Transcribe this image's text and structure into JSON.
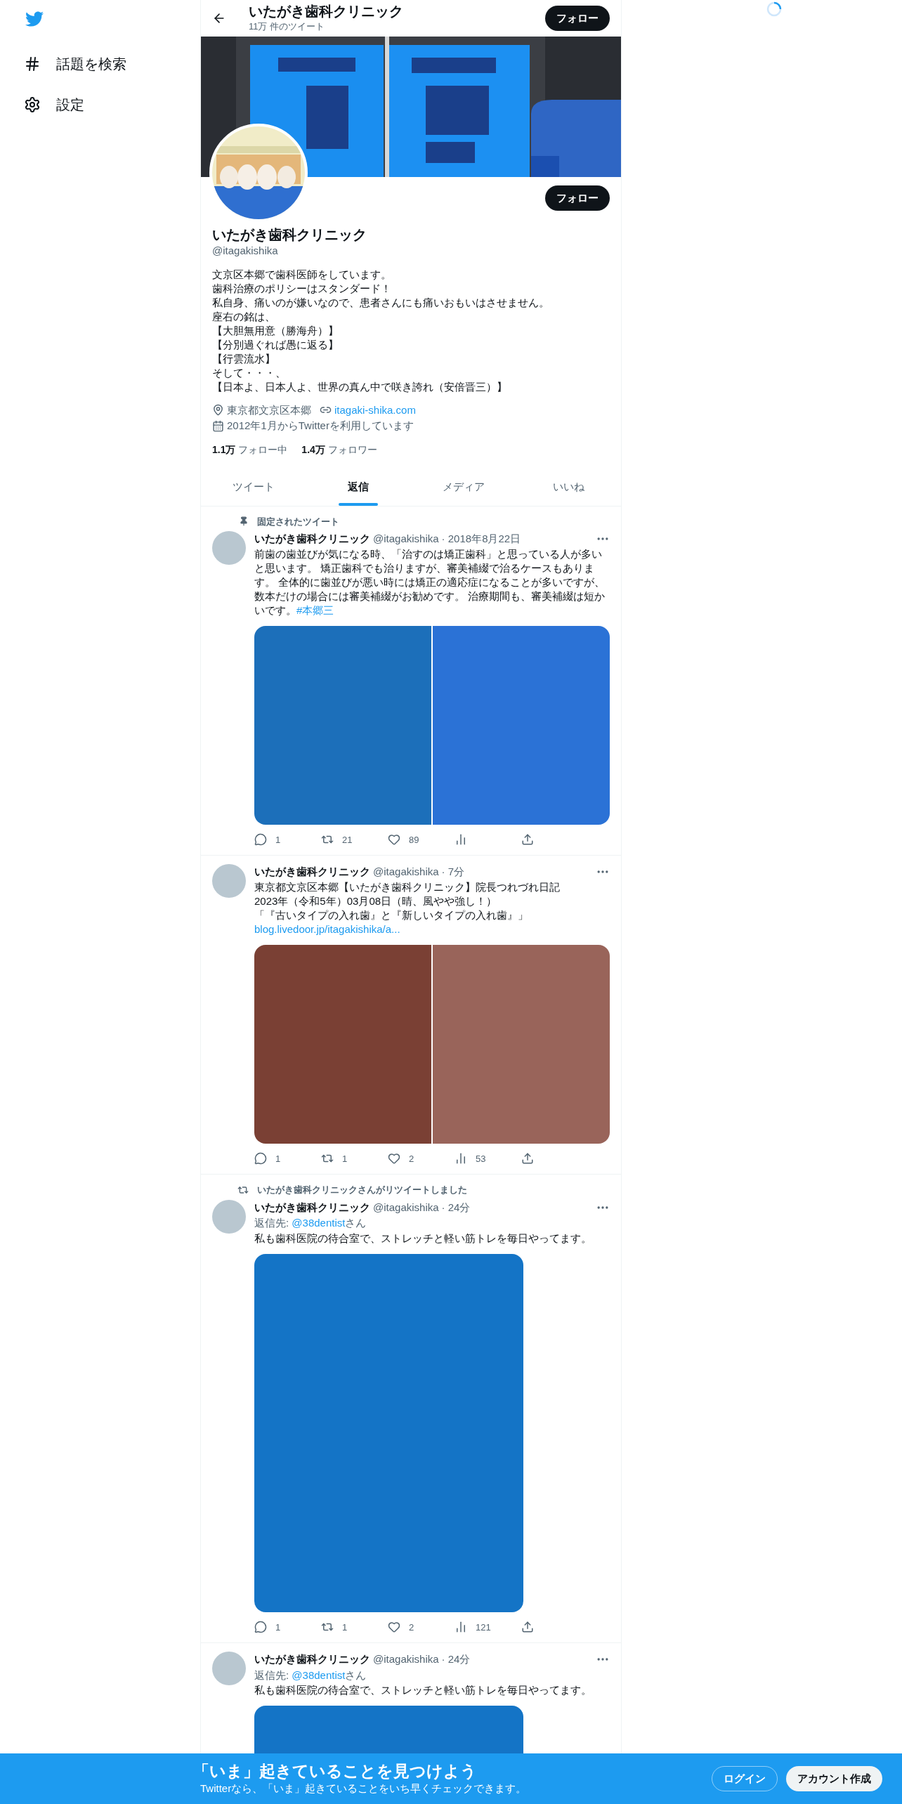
{
  "sidebar": {
    "items": [
      {
        "kind": "hash",
        "label": "話題を検索"
      },
      {
        "kind": "settings",
        "label": "設定"
      }
    ]
  },
  "header": {
    "title": "いたがき歯科クリニック",
    "subtitle": "11万 件のツイート",
    "follow_button": "フォロー"
  },
  "profile": {
    "follow_button": "フォロー",
    "name": "いたがき歯科クリニック",
    "handle": "@itagakishika",
    "bio": [
      "文京区本郷で歯科医師をしています。",
      "歯科治療のポリシーはスタンダード！",
      "私自身、痛いのが嫌いなので、患者さんにも痛いおもいはさせません。",
      "座右の銘は、",
      "【大胆無用意（勝海舟）】",
      "【分別過ぐれば愚に返る】",
      "【行雲流水】",
      "そして・・・、",
      "【日本よ、日本人よ、世界の真ん中で咲き誇れ（安倍晋三）】"
    ],
    "location": "東京都文京区本郷",
    "website": "itagaki-shika.com",
    "joined": "2012年1月からTwitterを利用しています",
    "following": {
      "count": "1.1万",
      "label": "フォロー中"
    },
    "followers": {
      "count": "1.4万",
      "label": "フォロワー"
    }
  },
  "tabs": [
    {
      "label": "ツイート",
      "selected": false
    },
    {
      "label": "返信",
      "selected": true
    },
    {
      "label": "メディア",
      "selected": false
    },
    {
      "label": "いいね",
      "selected": false
    }
  ],
  "tweets": [
    {
      "context": {
        "kind": "pinned",
        "text": "固定されたツイート"
      },
      "name": "いたがき歯科クリニック",
      "handle": "@itagakishika",
      "time": "· 2018年8月22日",
      "text": "前歯の歯並びが気になる時、「治すのは矯正歯科」と思っている人が多いと思います。 矯正歯科でも治りますが、審美補綴で治るケースもあります。 全体的に歯並びが悪い時には矯正の適応症になることが多いですが、数本だけの場合には審美補綴がお勧めです。 治療期間も、審美補綴は短かいです。",
      "hashtag": "#本郷三",
      "media": [
        {
          "color": "#1c6fba"
        },
        {
          "color": "#2b72d6"
        }
      ],
      "stats": {
        "replies": "1",
        "retweets": "21",
        "likes": "89"
      }
    },
    {
      "name": "いたがき歯科クリニック",
      "handle": "@itagakishika",
      "time": "· 7分",
      "lines": [
        "東京都文京区本郷【いたがき歯科クリニック】院長つれづれ日記",
        "2023年（令和5年）03月08日（晴、風やや強し！）",
        "「『古いタイプの入れ歯』と『新しいタイプの入れ歯』」"
      ],
      "link": "blog.livedoor.jp/itagakishika/a...",
      "media": [
        {
          "color": "#7a4034"
        },
        {
          "color": "#99645a"
        }
      ],
      "stats": {
        "replies": "1",
        "retweets": "1",
        "likes": "2",
        "views": "53"
      }
    },
    {
      "context": {
        "kind": "retweet",
        "text": "いたがき歯科クリニックさんがリツイートしました"
      },
      "name": "いたがき歯科クリニック",
      "handle": "@itagakishika",
      "time": "· 24分",
      "reply_to": {
        "label": "返信先: ",
        "user": "@38dentist",
        "suffix": "さん"
      },
      "text": "私も歯科医院の待合室で、ストレッチと軽い筋トレを毎日やってます。",
      "media": [
        {
          "color": "#1474c6"
        }
      ],
      "stats": {
        "replies": "1",
        "retweets": "1",
        "likes": "2",
        "views": "121"
      }
    },
    {
      "name": "いたがき歯科クリニック",
      "handle": "@itagakishika",
      "time": "· 24分",
      "reply_to": {
        "label": "返信先: ",
        "user": "@38dentist",
        "suffix": "さん"
      },
      "text": "私も歯科医院の待合室で、ストレッチと軽い筋トレを毎日やってます。",
      "media": [
        {
          "color": "#1474c6"
        }
      ]
    }
  ],
  "signup_bar": {
    "title": "「いま」起きていることを見つけよう",
    "subtitle": "Twitterなら、「いま」起きていることをいち早くチェックできます。",
    "login": "ログイン",
    "signup": "アカウント作成"
  }
}
